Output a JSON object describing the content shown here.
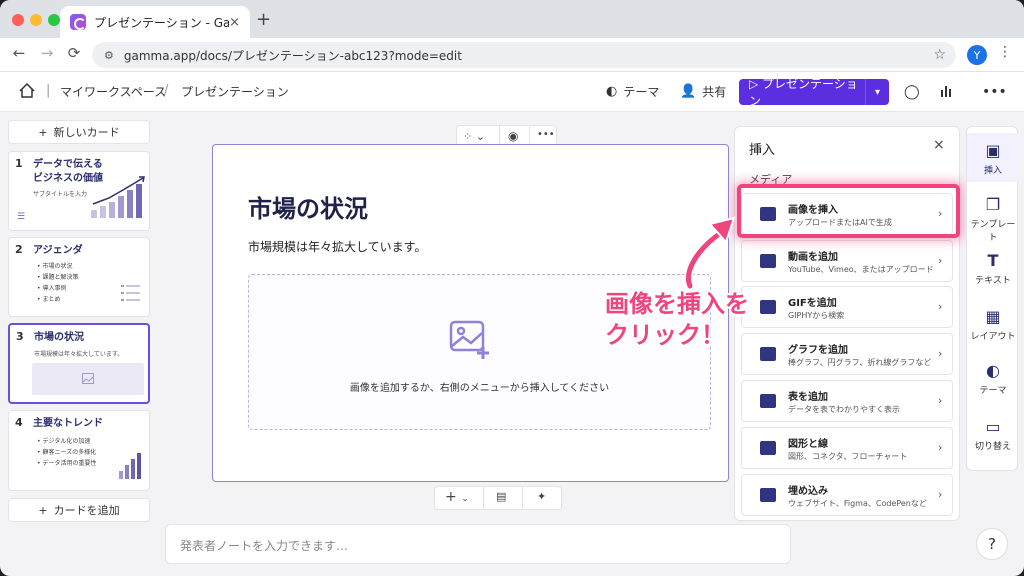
{
  "browser": {
    "tab_title": "プレゼンテーション - Gamma",
    "tab_close": "×",
    "new_tab": "+",
    "url": "gamma.app/docs/プレゼンテーション-abc123?mode=edit",
    "avatar_letter": "Y",
    "back": "←",
    "forward": "→",
    "reload": "⟳"
  },
  "header": {
    "breadcrumb": [
      "マイワークスペース",
      "プレゼンテーション"
    ],
    "separator": "/",
    "theme_label": "テーマ",
    "share_label": "共有",
    "present_label": "プレゼンテーション"
  },
  "sidebar": {
    "new_card": "新しいカード",
    "add_card": "カードを追加",
    "cards": [
      {
        "num": "1",
        "title_lines": [
          "データで伝える",
          "ビジネスの価値"
        ],
        "subtitle": "サブタイトルを入力"
      },
      {
        "num": "2",
        "title": "アジェンダ",
        "bullets": [
          "市場の状況",
          "課題と解決策",
          "導入事例",
          "まとめ"
        ]
      },
      {
        "num": "3",
        "title": "市場の状況",
        "subtitle": "市場規模は年々拡大しています。"
      },
      {
        "num": "4",
        "title": "主要なトレンド",
        "bullets": [
          "デジタル化の加速",
          "顧客ニーズの多様化",
          "データ活用の重要性"
        ]
      }
    ]
  },
  "card": {
    "title": "市場の状況",
    "body": "市場規模は年々拡大しています。",
    "drop_text": "画像を追加するか、右側のメニューから挿入してください"
  },
  "notes_placeholder": "発表者ノートを入力できます…",
  "panel": {
    "title": "挿入",
    "close": "×",
    "section": "メディア",
    "items": [
      {
        "title": "画像を挿入",
        "desc": "アップロードまたはAIで生成"
      },
      {
        "title": "動画を追加",
        "desc": "YouTube、Vimeo、またはアップロード"
      },
      {
        "title": "GIFを追加",
        "desc": "GIPHYから検索"
      },
      {
        "title": "グラフを追加",
        "desc": "棒グラフ、円グラフ、折れ線グラフなど"
      },
      {
        "title": "表を追加",
        "desc": "データを表でわかりやすく表示"
      },
      {
        "title": "図形と線",
        "desc": "図形、コネクタ、フローチャート"
      },
      {
        "title": "埋め込み",
        "desc": "ウェブサイト、Figma、CodePenなど"
      }
    ]
  },
  "rail": [
    {
      "label": "挿入",
      "icon": "insert-icon"
    },
    {
      "label": "テンプレート",
      "icon": "template-icon"
    },
    {
      "label": "テキスト",
      "icon": "text-icon"
    },
    {
      "label": "レイアウト",
      "icon": "layout-icon"
    },
    {
      "label": "テーマ",
      "icon": "palette-icon"
    },
    {
      "label": "切り替え",
      "icon": "transition-icon"
    }
  ],
  "help": "?",
  "annotation": [
    "画像を挿入を",
    "クリック！"
  ],
  "colors": {
    "accent": "#5b2ee0",
    "highlight": "#f0447e",
    "title_navy": "#1f2148"
  }
}
